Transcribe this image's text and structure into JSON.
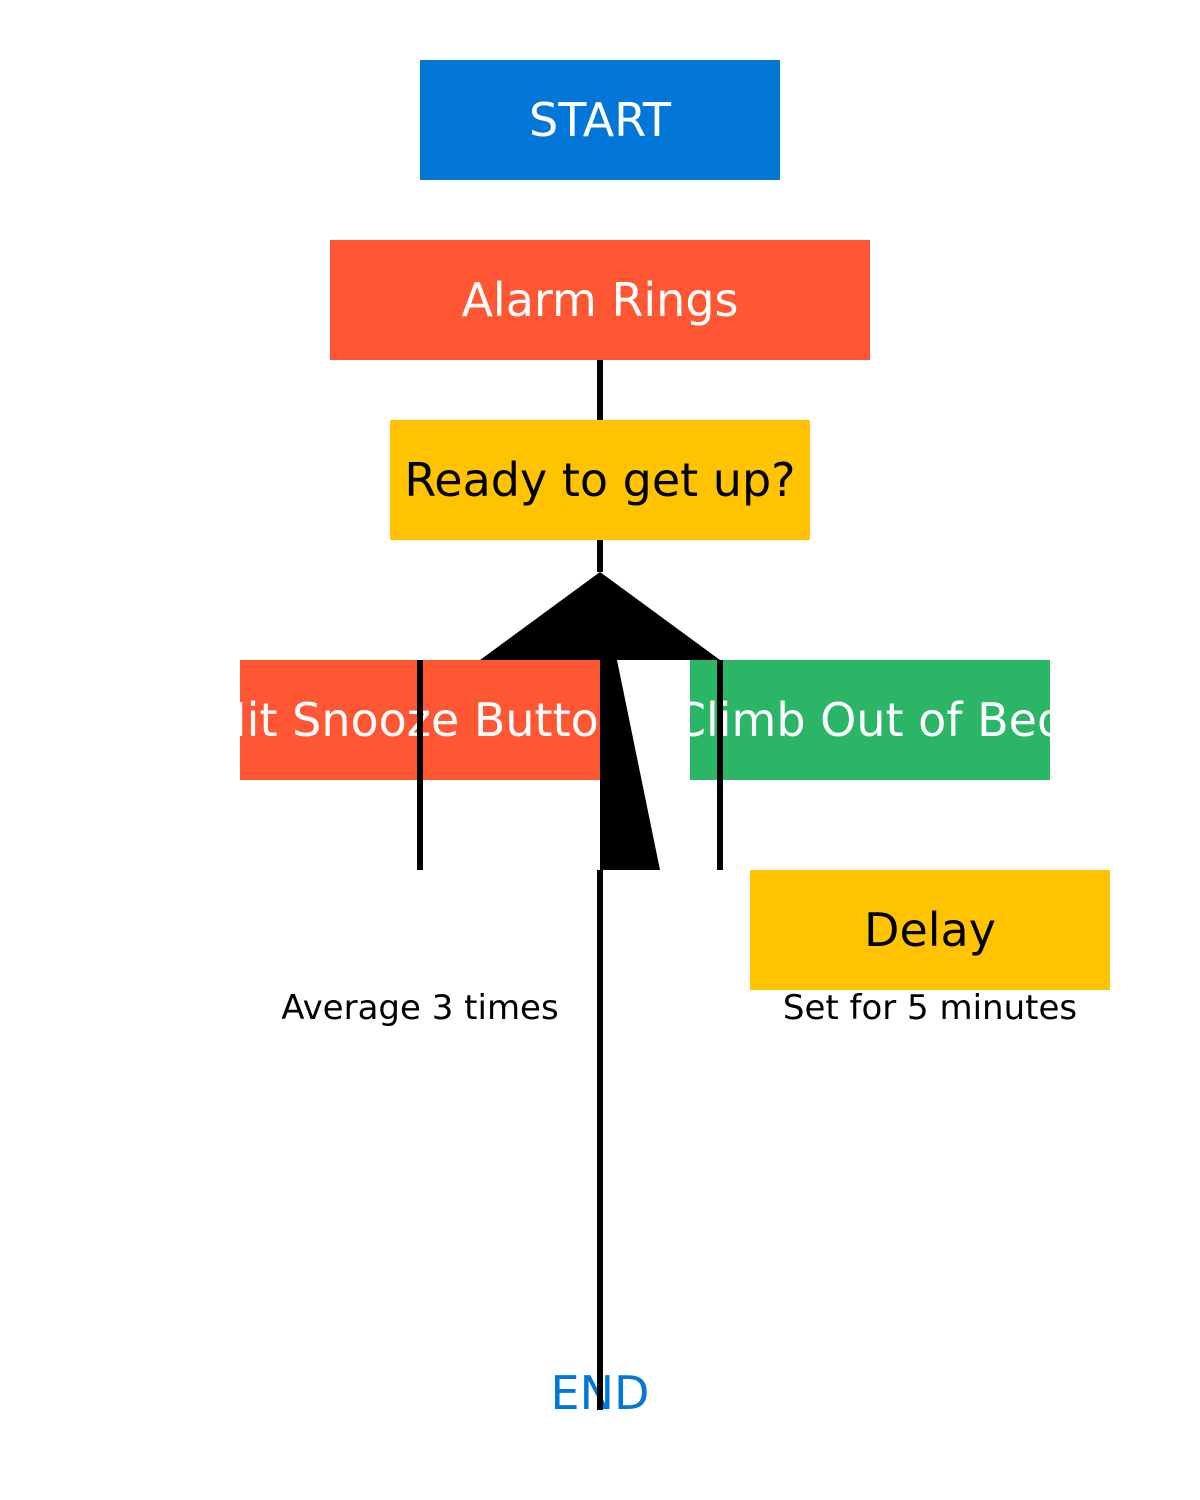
{
  "diagram": {
    "nodes": {
      "start": {
        "label": "START",
        "color": "#0277D8"
      },
      "alarm": {
        "label": "Alarm Rings",
        "color": "#FF5733"
      },
      "ready": {
        "label": "Ready to get up?",
        "color": "#FFC300"
      },
      "snooze": {
        "label": "Hit Snooze Button",
        "color": "#FF5733"
      },
      "climb": {
        "label": "Climb Out of Bed",
        "color": "#2BB566"
      },
      "delay": {
        "label": "Delay",
        "color": "#FFC300"
      }
    },
    "notes": {
      "snooze": "Average 3 times",
      "delay": "Set for 5 minutes"
    },
    "end": {
      "label": "END",
      "color": "#0277D8"
    },
    "line_color": "#000000"
  }
}
